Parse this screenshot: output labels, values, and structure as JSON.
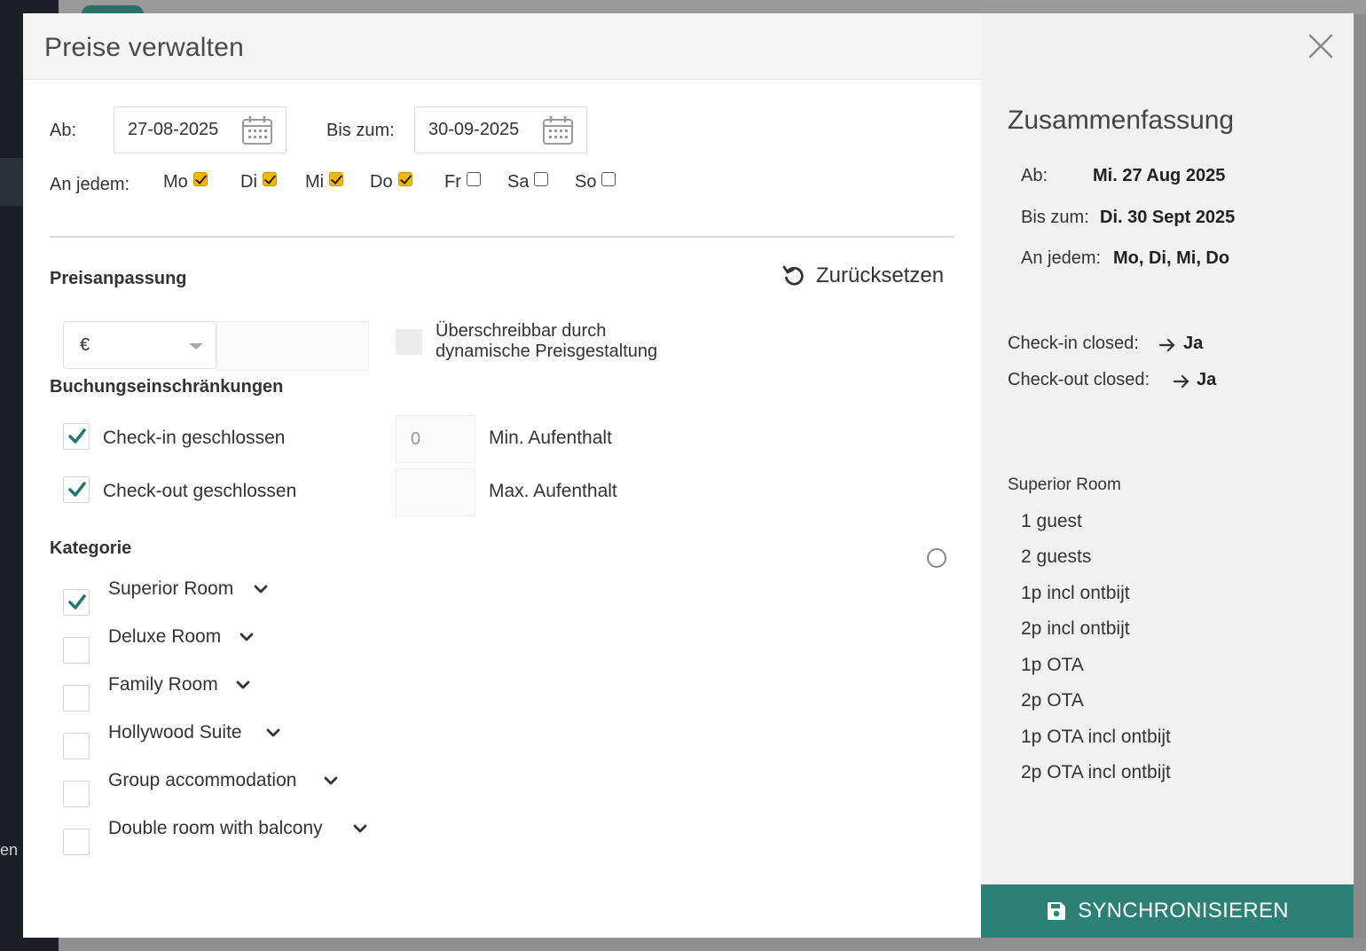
{
  "background": {
    "sidebar_fragment": "en"
  },
  "modal": {
    "title": "Preise verwalten",
    "from_label": "Ab:",
    "from_value": "27-08-2025",
    "to_label": "Bis zum:",
    "to_value": "30-09-2025",
    "weekday_label": "An jedem:",
    "weekdays": [
      {
        "label": "Mo",
        "checked": true
      },
      {
        "label": "Di",
        "checked": true
      },
      {
        "label": "Mi",
        "checked": true
      },
      {
        "label": "Do",
        "checked": true
      },
      {
        "label": "Fr",
        "checked": false
      },
      {
        "label": "Sa",
        "checked": false
      },
      {
        "label": "So",
        "checked": false
      }
    ],
    "price_adjust_heading": "Preisanpassung",
    "reset_label": "Zurücksetzen",
    "currency_value": "€",
    "override_line1": "Überschreibbar durch",
    "override_line2": "dynamische Preisgestaltung",
    "restrictions_heading": "Buchungseinschränkungen",
    "checkin_closed_label": "Check-in geschlossen",
    "checkout_closed_label": "Check-out geschlossen",
    "min_stay_value": "0",
    "min_stay_label": "Min. Aufenthalt",
    "max_stay_label": "Max. Aufenthalt",
    "category_heading": "Kategorie",
    "categories": [
      {
        "label": "Superior Room",
        "checked": true
      },
      {
        "label": "Deluxe Room",
        "checked": false
      },
      {
        "label": "Family Room",
        "checked": false
      },
      {
        "label": "Hollywood Suite",
        "checked": false
      },
      {
        "label": "Group accommodation",
        "checked": false
      },
      {
        "label": "Double room with balcony",
        "checked": false
      }
    ]
  },
  "summary": {
    "title": "Zusammenfassung",
    "from_label": "Ab:",
    "from_value": "Mi. 27 Aug 2025",
    "to_label": "Bis zum:",
    "to_value": "Di. 30 Sept 2025",
    "days_label": "An jedem:",
    "days_value": "Mo, Di, Mi, Do",
    "checkin_label": "Check-in closed:",
    "checkin_value": "Ja",
    "checkout_label": "Check-out closed:",
    "checkout_value": "Ja",
    "room_name": "Superior Room",
    "rates": [
      "1 guest",
      "2 guests",
      "1p incl ontbijt",
      "2p incl ontbijt",
      "1p OTA",
      "2p OTA",
      "1p OTA incl ontbijt",
      "2p OTA incl ontbijt"
    ],
    "sync_label": "SYNCHRONISIEREN"
  },
  "colors": {
    "accent": "#2a8174",
    "weekday_check": "#f5b800",
    "checkmark": "#1f7a6d"
  }
}
